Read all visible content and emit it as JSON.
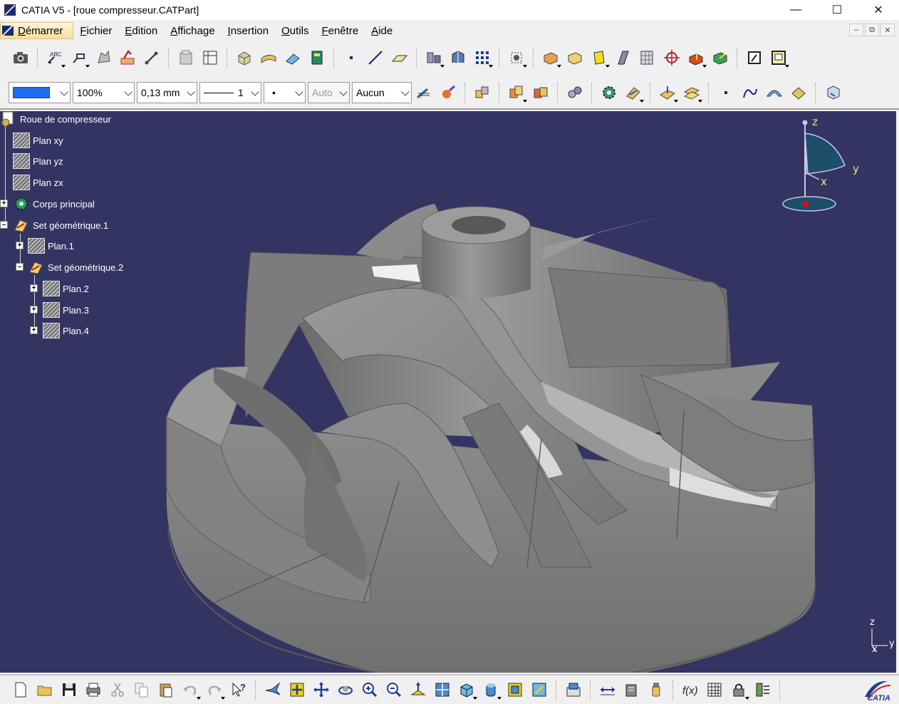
{
  "window": {
    "title": "CATIA V5 - [roue compresseur.CATPart]",
    "controls": [
      "minimize",
      "maximize",
      "close"
    ]
  },
  "menubar": {
    "start": "Démarrer",
    "items": [
      "Fichier",
      "Edition",
      "Affichage",
      "Insertion",
      "Outils",
      "Fenêtre",
      "Aide"
    ]
  },
  "toolbar_properties": {
    "color_value": "#1d6cf0",
    "transparency": "100%",
    "line_thickness": "0,13 mm",
    "line_type": "1",
    "point_type": "•",
    "layer_auto": "Auto",
    "layer": "Aucun"
  },
  "tree": {
    "root": "Roue de compresseur",
    "nodes": [
      {
        "label": "Plan xy",
        "icon": "plane-icon"
      },
      {
        "label": "Plan yz",
        "icon": "plane-icon"
      },
      {
        "label": "Plan zx",
        "icon": "plane-icon"
      },
      {
        "label": "Corps principal",
        "icon": "gear-icon"
      },
      {
        "label": "Set géométrique.1",
        "icon": "geometric-set-icon"
      },
      {
        "label": "Plan.1",
        "icon": "plane-icon"
      },
      {
        "label": "Set géométrique.2",
        "icon": "geometric-set-icon"
      },
      {
        "label": "Plan.2",
        "icon": "plane-icon"
      },
      {
        "label": "Plan.3",
        "icon": "plane-icon"
      },
      {
        "label": "Plan.4",
        "icon": "plane-icon"
      }
    ]
  },
  "compass": {
    "z": "z",
    "y": "y",
    "x": "x"
  },
  "mini_axes": {
    "z": "z",
    "y": "y",
    "x": "x"
  },
  "logo_text": "CATIA",
  "colors": {
    "viewport_bg": "#343463",
    "model_gray": "#8a8a8a",
    "compass_fill": "#1e4f68"
  }
}
